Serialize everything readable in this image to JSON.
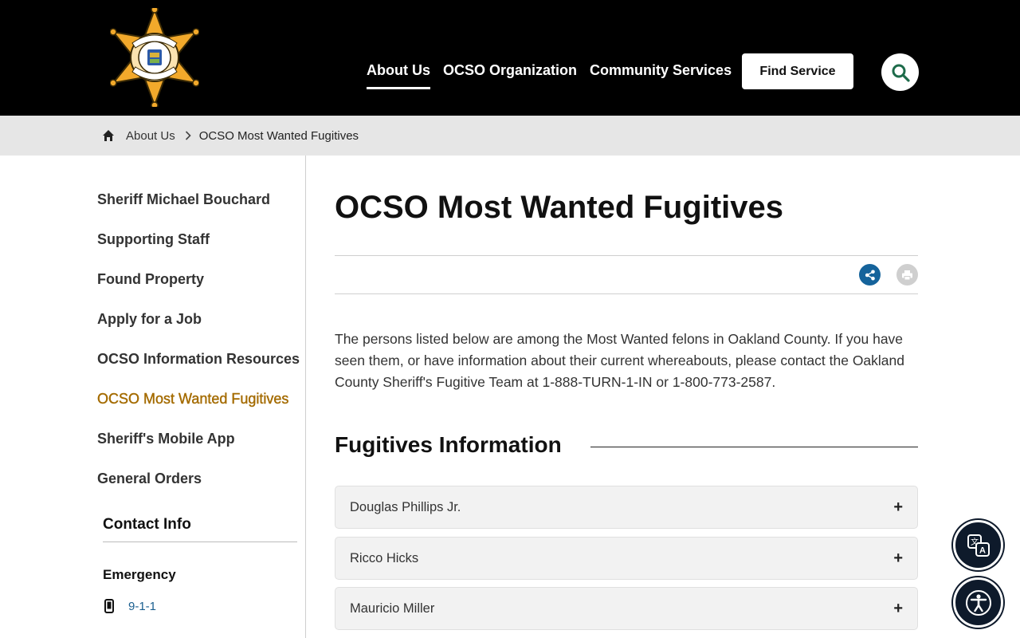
{
  "header": {
    "logo": {
      "text_top": "SHERIFF",
      "text_bottom": "OAKLAND COUNTY"
    },
    "nav": [
      {
        "label": "About Us",
        "active": true
      },
      {
        "label": "OCSO Organization",
        "active": false
      },
      {
        "label": "Community Services",
        "active": false
      }
    ],
    "find_service_label": "Find Service",
    "search_icon": "search-icon"
  },
  "breadcrumb": {
    "home_icon": "home-icon",
    "items": [
      "About Us",
      "OCSO Most Wanted Fugitives"
    ]
  },
  "sidebar": {
    "items": [
      {
        "label": "Sheriff Michael Bouchard",
        "active": false
      },
      {
        "label": "Supporting Staff",
        "active": false
      },
      {
        "label": "Found Property",
        "active": false
      },
      {
        "label": "Apply for a Job",
        "active": false
      },
      {
        "label": "OCSO Information Resources",
        "active": false
      },
      {
        "label": "OCSO Most Wanted Fugitives",
        "active": true
      },
      {
        "label": "Sheriff's Mobile App",
        "active": false
      },
      {
        "label": "General Orders",
        "active": false
      }
    ],
    "contact_title": "Contact Info",
    "emergency_label": "Emergency",
    "emergency_phone": "9-1-1"
  },
  "main": {
    "title": "OCSO Most Wanted Fugitives",
    "intro": "The persons listed below are among the Most Wanted felons in Oakland County. If you have seen them, or have information about their current whereabouts, please contact the Oakland County Sheriff's Fugitive Team at 1-888-TURN-1-IN or 1-800-773-2587.",
    "section_title": "Fugitives Information",
    "fugitives": [
      "Douglas Phillips Jr.",
      "Ricco Hicks",
      "Mauricio Miller"
    ]
  },
  "colors": {
    "header_bg": "#000000",
    "active_sidebar": "#a46b00",
    "share": "#15639b",
    "link": "#1a5f8f",
    "badge_gold": "#f2a92b"
  }
}
